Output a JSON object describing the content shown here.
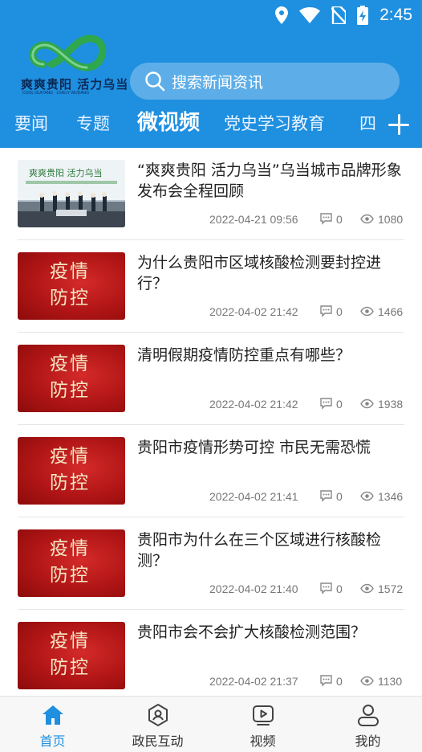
{
  "status_bar": {
    "time": "2:45"
  },
  "colors": {
    "header_bg": "#1f8fe0",
    "active_tab_bottom": "#1f8fe0",
    "thumb_red": "#b01515",
    "logo_green": "#2ea84a"
  },
  "logo": {
    "text": "爽爽贵阳 活力乌当",
    "subtext": "COOL GUIYANG · LIVELY WUDANG"
  },
  "search": {
    "placeholder": "搜索新闻资讯"
  },
  "tabs": [
    {
      "label": "要闻",
      "active": false
    },
    {
      "label": "专题",
      "active": false
    },
    {
      "label": "微视频",
      "active": true
    },
    {
      "label": "党史学习教育",
      "active": false
    },
    {
      "label": "四",
      "active": false
    }
  ],
  "news": [
    {
      "title": "“爽爽贵阳 活力乌当”乌当城市品牌形象发布会全程回顾",
      "date": "2022-04-21 09:56",
      "comments": "0",
      "views": "1080",
      "thumb": "photo"
    },
    {
      "title": "为什么贵阳市区域核酸检测要封控进行？",
      "date": "2022-04-02 21:42",
      "comments": "0",
      "views": "1466",
      "thumb": "red",
      "thumb_text": "疫情防控"
    },
    {
      "title": "清明假期疫情防控重点有哪些？",
      "date": "2022-04-02 21:42",
      "comments": "0",
      "views": "1938",
      "thumb": "red",
      "thumb_text": "疫情防控"
    },
    {
      "title": "贵阳市疫情形势可控 市民无需恐慌",
      "date": "2022-04-02 21:41",
      "comments": "0",
      "views": "1346",
      "thumb": "red",
      "thumb_text": "疫情防控"
    },
    {
      "title": "贵阳市为什么在三个区域进行核酸检测？",
      "date": "2022-04-02 21:40",
      "comments": "0",
      "views": "1572",
      "thumb": "red",
      "thumb_text": "疫情防控"
    },
    {
      "title": "贵阳市会不会扩大核酸检测范围？",
      "date": "2022-04-02 21:37",
      "comments": "0",
      "views": "1130",
      "thumb": "red",
      "thumb_text": "疫情防控"
    }
  ],
  "bottom_nav": [
    {
      "label": "首页",
      "icon": "home-icon",
      "active": true
    },
    {
      "label": "政民互动",
      "icon": "hexagon-icon",
      "active": false
    },
    {
      "label": "视频",
      "icon": "video-icon",
      "active": false
    },
    {
      "label": "我的",
      "icon": "user-icon",
      "active": false
    }
  ]
}
